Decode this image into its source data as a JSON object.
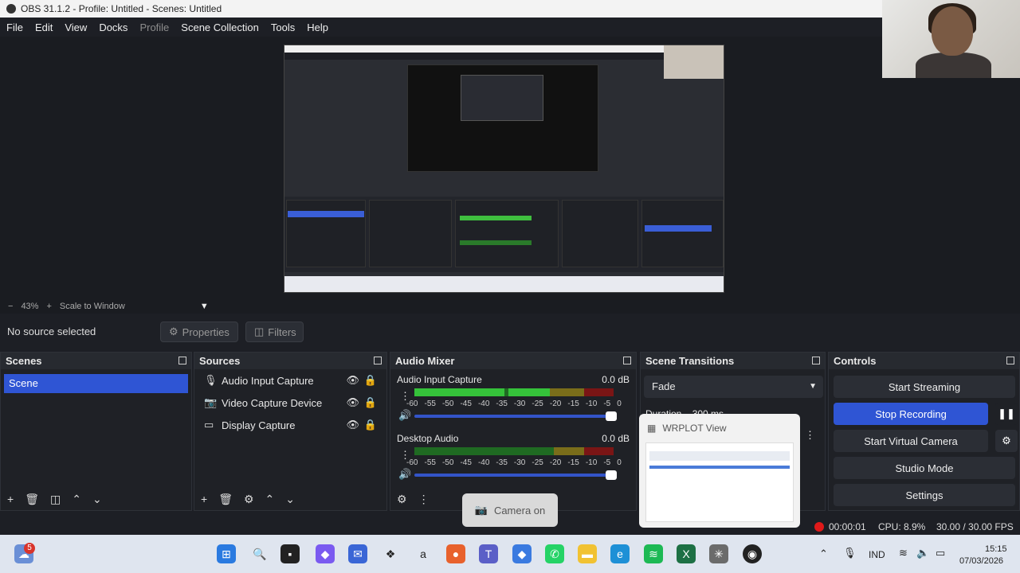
{
  "window": {
    "title": "OBS 31.1.2 - Profile: Untitled - Scenes: Untitled"
  },
  "menu": [
    "File",
    "Edit",
    "View",
    "Docks",
    "Profile",
    "Scene Collection",
    "Tools",
    "Help"
  ],
  "zoom": {
    "minus": "−",
    "percent": "43%",
    "plus": "+",
    "mode": "Scale to Window"
  },
  "source_bar": {
    "none": "No source selected",
    "properties": "Properties",
    "filters": "Filters"
  },
  "scenes": {
    "title": "Scenes",
    "items": [
      "Scene"
    ]
  },
  "sources": {
    "title": "Sources",
    "items": [
      {
        "name": "Audio Input Capture",
        "icon": "microphone-icon"
      },
      {
        "name": "Video Capture Device",
        "icon": "camera-icon"
      },
      {
        "name": "Display Capture",
        "icon": "monitor-icon"
      }
    ]
  },
  "mixer": {
    "title": "Audio Mixer",
    "channels": [
      {
        "name": "Audio Input Capture",
        "db": "0.0 dB",
        "level": 0.68
      },
      {
        "name": "Desktop Audio",
        "db": "0.0 dB",
        "level": 0.0
      }
    ],
    "ticks": [
      "-60",
      "-55",
      "-50",
      "-45",
      "-40",
      "-35",
      "-30",
      "-25",
      "-20",
      "-15",
      "-10",
      "-5",
      "0"
    ]
  },
  "transitions": {
    "title": "Scene Transitions",
    "selected": "Fade",
    "duration_label": "Duration",
    "duration_value": "300 ms"
  },
  "controls": {
    "title": "Controls",
    "start_streaming": "Start Streaming",
    "stop_recording": "Stop Recording",
    "start_virtual_camera": "Start Virtual Camera",
    "studio_mode": "Studio Mode",
    "settings": "Settings"
  },
  "status": {
    "rec_time": "00:00:01",
    "cpu": "CPU: 8.9%",
    "fps": "30.00 / 30.00 FPS"
  },
  "camera_tooltip": "Camera on",
  "wrplot": {
    "title": "WRPLOT View"
  },
  "taskbar": {
    "lang": "IND",
    "time": "15:15",
    "date": "07/03/2026",
    "badge": "5"
  }
}
